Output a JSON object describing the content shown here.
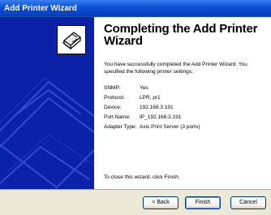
{
  "window": {
    "title": "Add Printer Wizard"
  },
  "heading": "Completing the Add Printer Wizard",
  "intro": "You have successfully completed the Add Printer Wizard. You specified the following printer settings:",
  "settings": [
    {
      "label": "SNMP:",
      "value": "Yes"
    },
    {
      "label": "Protocol:",
      "value": "LPR, pr1"
    },
    {
      "label": "Device:",
      "value": "192.168.3.191"
    },
    {
      "label": "Port Name:",
      "value": "IP_192.168.3.191"
    },
    {
      "label": "Adapter Type:",
      "value": "Axis Print Server (3 ports)"
    }
  ],
  "closing": "To close this wizard, click Finish.",
  "buttons": {
    "back": "< Back",
    "finish": "Finish",
    "cancel": "Cancel"
  },
  "icons": {
    "wizard": "printer-icon"
  },
  "colors": {
    "banner": "#0b22a8",
    "titlebar": "#0a4fd8",
    "dialog": "#ece9d8"
  }
}
